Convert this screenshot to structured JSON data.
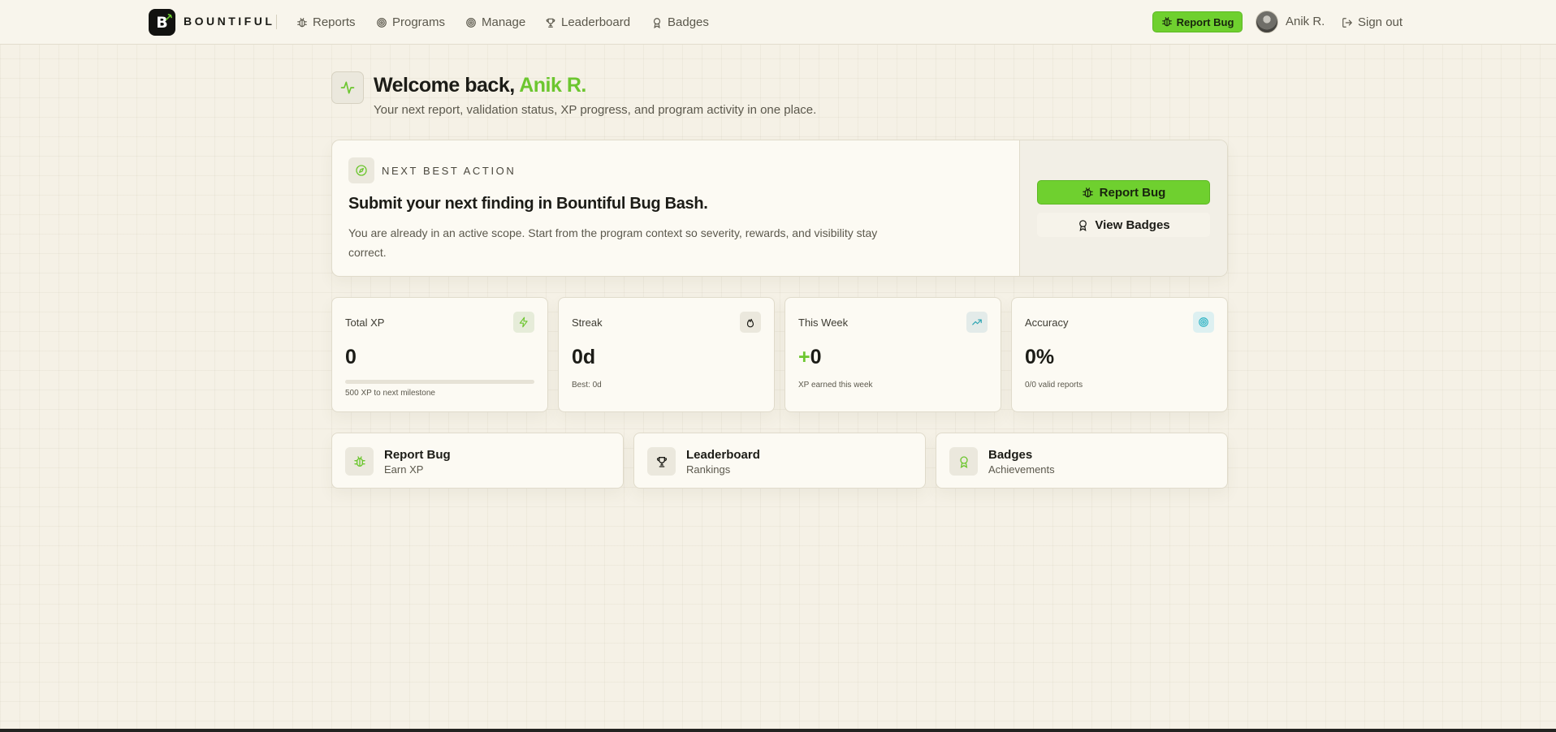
{
  "colors": {
    "accent": "#6fd02f",
    "accent_text": "#6cc62f",
    "background": "#f5f1e6",
    "card": "#fcfaf3"
  },
  "header": {
    "logo_letter": "B",
    "brand": "BOUNTIFUL",
    "nav": [
      {
        "label": "Reports",
        "icon": "bug-icon"
      },
      {
        "label": "Programs",
        "icon": "target-icon"
      },
      {
        "label": "Manage",
        "icon": "target-icon"
      },
      {
        "label": "Leaderboard",
        "icon": "trophy-icon"
      },
      {
        "label": "Badges",
        "icon": "award-icon"
      }
    ],
    "report_bug": "Report Bug",
    "user_name": "Anik R.",
    "sign_out": "Sign out"
  },
  "welcome": {
    "title_prefix": "Welcome back, ",
    "user": "Anik R.",
    "subtitle": "Your next report, validation status, XP progress, and program activity in one place."
  },
  "next_action": {
    "eyebrow": "NEXT BEST ACTION",
    "title": "Submit your next finding in Bountiful Bug Bash.",
    "description": "You are already in an active scope. Start from the program context so severity, rewards, and visibility stay correct.",
    "primary_button": "Report Bug",
    "secondary_button": "View Badges"
  },
  "stats": [
    {
      "label": "Total XP",
      "value": "0",
      "note": "500 XP to next milestone",
      "progress": 0,
      "icon": "zap-icon"
    },
    {
      "label": "Streak",
      "value": "0d",
      "note": "Best: 0d",
      "icon": "flame-icon"
    },
    {
      "label": "This Week",
      "value_prefix": "+",
      "value": "0",
      "note": "XP earned this week",
      "icon": "trending-up-icon"
    },
    {
      "label": "Accuracy",
      "value": "0%",
      "note": "0/0 valid reports",
      "icon": "target-icon"
    }
  ],
  "quick_links": [
    {
      "title": "Report Bug",
      "subtitle": "Earn XP",
      "icon": "bug-icon"
    },
    {
      "title": "Leaderboard",
      "subtitle": "Rankings",
      "icon": "trophy-icon"
    },
    {
      "title": "Badges",
      "subtitle": "Achievements",
      "icon": "award-icon"
    }
  ]
}
